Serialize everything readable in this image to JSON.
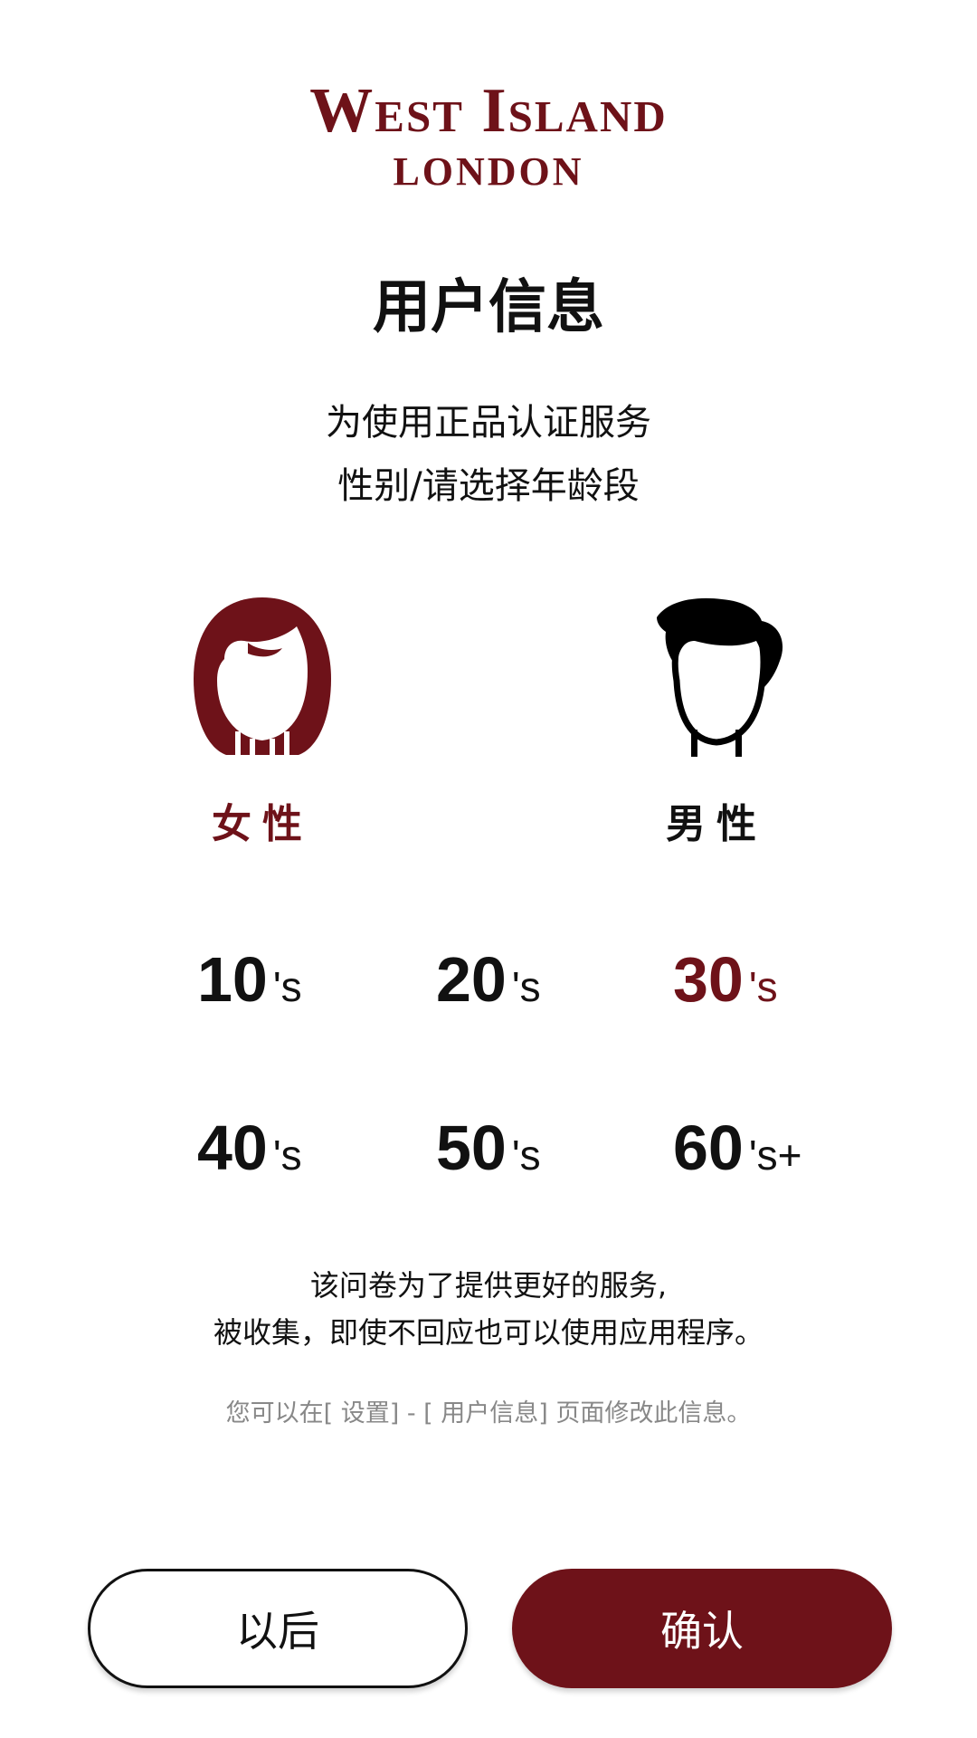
{
  "logo": {
    "line1": "West Island",
    "line2": "LONDON"
  },
  "title": "用户信息",
  "subtitle": {
    "line1": "为使用正品认证服务",
    "line2": "性别/请选择年龄段"
  },
  "gender": {
    "female_label": "女性",
    "male_label": "男性",
    "selected": "female"
  },
  "ages": [
    {
      "num": "10",
      "suffix": "'s"
    },
    {
      "num": "20",
      "suffix": "'s"
    },
    {
      "num": "30",
      "suffix": "'s"
    },
    {
      "num": "40",
      "suffix": "'s"
    },
    {
      "num": "50",
      "suffix": "'s"
    },
    {
      "num": "60",
      "suffix": "'s+"
    }
  ],
  "selected_age": "30's",
  "note": {
    "line1": "该问卷为了提供更好的服务,",
    "line2": "被收集，即使不回应也可以使用应用程序。"
  },
  "hint": "您可以在[ 设置] - [ 用户信息] 页面修改此信息。",
  "buttons": {
    "later": "以后",
    "confirm": "确认"
  },
  "colors": {
    "accent": "#6e1219",
    "text": "#111111",
    "hint": "#888888",
    "background": "#ffffff"
  }
}
